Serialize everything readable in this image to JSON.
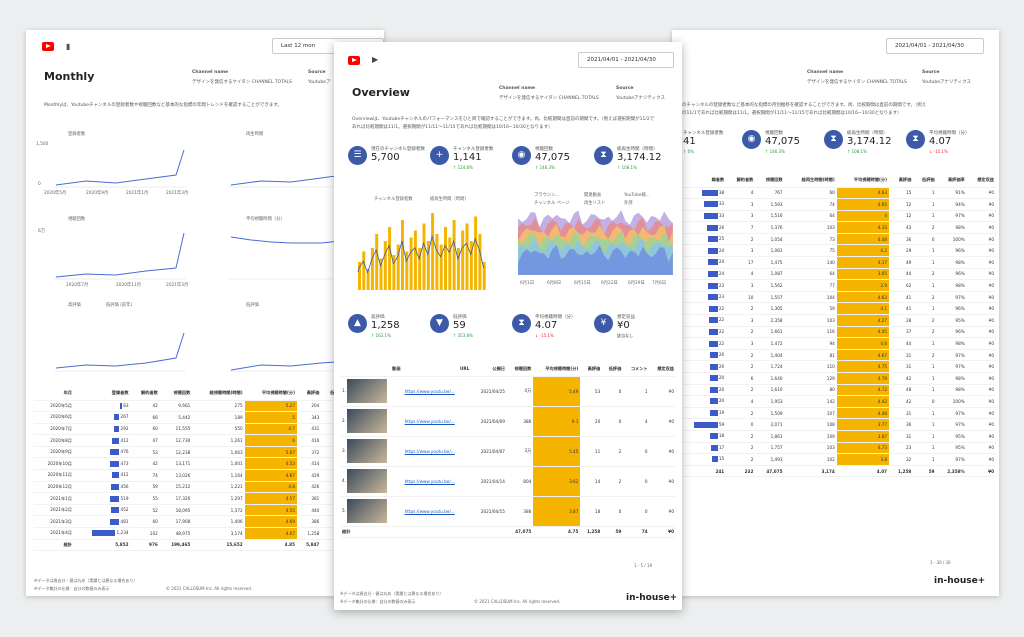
{
  "left": {
    "title": "Monthly",
    "selector": "Last 12 mon",
    "channel_label": "Channel name",
    "channel_value": "デザインを発信するケイタン CHANNEL TOTALS",
    "source_label": "Source",
    "source_value": "Youtubeア",
    "desc": "Monthlyは、Youtubeチャンネルの登録者数や視聴回数など基本的な指標の年間トレンドを確認することができます。",
    "chart_titles": [
      "登録者数",
      "再生時間",
      "視聴回数",
      "平均視聴時間（分）",
      "高評価",
      "低評価"
    ],
    "x_ticks": [
      "2020年5月",
      "2020年9月",
      "2021年1月",
      "2021年3月"
    ],
    "x_ticks_b": [
      "2020年7月",
      "2020年11月",
      "2021年3月"
    ],
    "y_ticks": [
      "1,500",
      "1,000",
      "500",
      "0"
    ],
    "y_ticks_b": [
      "6万",
      "4万",
      "2万",
      "0"
    ],
    "legend_hi": "高評価",
    "legend_lo": "低評価 (前年)",
    "cols": [
      "年月",
      "登録者数",
      "解約者数",
      "視聴回数",
      "総視聴時間(時間)",
      "平均視聴時間(分)",
      "高評価",
      "低評価",
      "高評価率"
    ],
    "rows": [
      [
        "2020年5月",
        "83",
        "42",
        "9,661",
        "275",
        "5.27",
        "204",
        "11",
        "95"
      ],
      [
        "2020年6月",
        "267",
        "66",
        "5,442",
        "189",
        "5",
        "343",
        "4",
        "98"
      ],
      [
        "2020年7月",
        "292",
        "60",
        "11,555",
        "550",
        "4.7",
        "431",
        "7",
        "98"
      ],
      [
        "2020年8月",
        "412",
        "47",
        "12,730",
        "1,261",
        "6",
        "410",
        "10",
        "97"
      ],
      [
        "2020年9月",
        "476",
        "53",
        "12,238",
        "1,063",
        "5.67",
        "372",
        "7",
        "97"
      ],
      [
        "2020年10月",
        "473",
        "42",
        "13,171",
        "1,001",
        "4.53",
        "414",
        "10",
        "97"
      ],
      [
        "2020年11月",
        "412",
        "74",
        "13,026",
        "1,164",
        "4.67",
        "429",
        "9",
        "97"
      ],
      [
        "2020年12月",
        "456",
        "59",
        "15,212",
        "1,221",
        "4.8",
        "426",
        "11",
        "97"
      ],
      [
        "2021年1月",
        "519",
        "55",
        "17,320",
        "1,297",
        "4.57",
        "381",
        "8",
        "97"
      ],
      [
        "2021年2月",
        "452",
        "52",
        "18,095",
        "1,372",
        "4.55",
        "440",
        "8",
        "98"
      ],
      [
        "2021年3月",
        "481",
        "60",
        "17,908",
        "1,406",
        "4.69",
        "386",
        "8",
        "98"
      ],
      [
        "2021年4月",
        "1,234",
        "102",
        "48,975",
        "3,174",
        "4.07",
        "1,258",
        "59",
        "95"
      ]
    ],
    "total": [
      "総計",
      "5,852",
      "976",
      "199,465",
      "15,652",
      "4.85",
      "5,847",
      "116",
      "1,1701"
    ],
    "foot1": "※データは過去分・値は丸め（実績とは異なる場合あり）",
    "foot2": "※データ集計の仕様：自分の数値のみ表示",
    "copyright": "© 2021 CALLOSUM Inc. All rights reserved."
  },
  "center": {
    "title": "Overview",
    "selector": "2021/04/01 - 2021/04/30",
    "channel_label": "Channel name",
    "channel_value": "デザインを発信するケイタン CHANNEL TOTALS",
    "source_label": "Source",
    "source_value": "Youtubeアナリティクス",
    "desc": "Overviewは、Youtubeチャンネルのパフォーマンスをひと目で確認することができます。尚、比較期間は直前の期間です。（例えば選択期間が11/2で",
    "desc2": "あれば比較期間は11/1。選択期間が11/11～11/15であれば比較期間は10/16~10/30となります）",
    "kpis1": [
      {
        "t": "現在のチャンネル登録者数",
        "v": "5,700",
        "d": "",
        "icon": "subscribers-icon"
      },
      {
        "t": "チャンネル登録者数",
        "v": "1,141",
        "d": "↑ 124.8%",
        "c": "up",
        "icon": "add-user-icon"
      },
      {
        "t": "視聴回数",
        "v": "47,075",
        "d": "↑ 146.3%",
        "c": "up",
        "icon": "eye-icon"
      },
      {
        "t": "総再生時間（時間）",
        "v": "3,174.12",
        "d": "↑ 108.1%",
        "c": "up",
        "icon": "hourglass-icon"
      }
    ],
    "kpis2": [
      {
        "t": "高評価",
        "v": "1,258",
        "d": "↑ 162.1%",
        "c": "up",
        "icon": "thumb-up-icon"
      },
      {
        "t": "低評価",
        "v": "59",
        "d": "↑ 353.8%",
        "c": "up",
        "icon": "thumb-down-icon"
      },
      {
        "t": "平均視聴時間（分）",
        "v": "4.07",
        "d": "↓ -15.1%",
        "c": "dn",
        "icon": "hourglass-icon"
      },
      {
        "t": "想定収益",
        "v": "¥0",
        "d": "該当なし",
        "c": "",
        "icon": "revenue-icon"
      }
    ],
    "legend_a": "チャンネル登録者数",
    "legend_b": "総再生時間（時間）",
    "legend_traffic": [
      "ブラウジン...",
      "関連動画",
      "YouTube検...",
      "チャンネル ページ",
      "再生リスト",
      "外部"
    ],
    "chart_ylab": [
      "150",
      "100",
      "50",
      "0"
    ],
    "chart_xlab": [
      "6月1日",
      "6月8日",
      "6月15日",
      "6月22日",
      "6月29日",
      "7月6日"
    ],
    "video_cols": [
      "動画",
      "URL",
      "公開日",
      "視聴回数",
      "平均視聴時間(分)",
      "高評価",
      "低評価",
      "コメント",
      "想定収益"
    ],
    "videos": [
      [
        "1.",
        "https://www.youtu.be/...",
        "2021/04/25",
        "4万",
        "5.49",
        "53",
        "0",
        "1",
        "¥0"
      ],
      [
        "2.",
        "https://www.youtu.be/...",
        "2021/04/09",
        "386",
        "9.1",
        "20",
        "0",
        "4",
        "¥0"
      ],
      [
        "3.",
        "https://www.youtu.be/...",
        "2021/04/07",
        "3万",
        "5.45",
        "11",
        "2",
        "0",
        "¥0"
      ],
      [
        "4.",
        "https://www.youtu.be/...",
        "2021/04/14",
        "804",
        "3.62",
        "14",
        "2",
        "0",
        "¥0"
      ],
      [
        "5.",
        "https://www.youtu.be/...",
        "2021/04/15",
        "386",
        "3.87",
        "18",
        "0",
        "0",
        "¥0"
      ]
    ],
    "video_total": [
      "総計",
      "47,075",
      "4.75",
      "1,258",
      "59",
      "74",
      "¥0"
    ],
    "pager": "1 - 5 / 19",
    "foot1": "※データは過去分・値は丸め（実績とは異なる場合あり）",
    "foot2": "※データ集計の仕様：自分の数値のみ表示",
    "copyright": "© 2021 CALLOSUM Inc. All rights reserved.",
    "brand": "in-house+"
  },
  "right": {
    "selector": "2021/04/01 - 2021/04/30",
    "source_label": "Source",
    "source_value": "Youtubeアナリティクス",
    "channel_label": "Channel name",
    "channel_value": "デザインを発信するケイタン CHANNEL TOTALS",
    "desc": "のチャンネルの登録者数など基本的な指標の月別推移を確認することができます。尚、比較期間は直前の期間です。（例え",
    "desc2": "の11/1であれば比較期間は11/1。選択期間が11/11～11/15であれば比較期間は10/16~10/30となります）",
    "kpis": [
      {
        "t": "チャンネル登録者数",
        "v": "41",
        "d": "↑ 0%",
        "c": "up",
        "icon": "subscribers-icon"
      },
      {
        "t": "視聴回数",
        "v": "47,075",
        "d": "↑ 146.3%",
        "c": "up",
        "icon": "eye-icon"
      },
      {
        "t": "総再生時間（時間）",
        "v": "3,174.12",
        "d": "↑ 108.1%",
        "c": "up",
        "icon": "hourglass-icon"
      },
      {
        "t": "平均視聴時間（分）",
        "v": "4.07",
        "d": "↓ -15.1%",
        "c": "dn",
        "icon": "hourglass-icon"
      }
    ],
    "cols": [
      "録者数",
      "解約者数",
      "視聴回数",
      "総再生時間(時間)",
      "平均視聴時間(分)",
      "高評価",
      "低評価",
      "高評価率",
      "想定収益"
    ],
    "rows": [
      [
        "38",
        "4",
        "767",
        "60",
        "4.63",
        "15",
        "1",
        "91%",
        "¥0"
      ],
      [
        "33",
        "3",
        "1,593",
        "74",
        "4.65",
        "12",
        "1",
        "94%",
        "¥0"
      ],
      [
        "33",
        "3",
        "1,516",
        "64",
        "4",
        "12",
        "1",
        "97%",
        "¥0"
      ],
      [
        "26",
        "7",
        "1,376",
        "103",
        "4.33",
        "43",
        "2",
        "98%",
        "¥0"
      ],
      [
        "25",
        "2",
        "1,054",
        "73",
        "4.48",
        "36",
        "0",
        "100%",
        "¥0"
      ],
      [
        "24",
        "3",
        "1,081",
        "75",
        "4.2",
        "29",
        "1",
        "96%",
        "¥0"
      ],
      [
        "24",
        "17",
        "1,475",
        "140",
        "4.17",
        "49",
        "1",
        "98%",
        "¥0"
      ],
      [
        "24",
        "4",
        "1,087",
        "64",
        "3.65",
        "44",
        "2",
        "96%",
        "¥0"
      ],
      [
        "23",
        "3",
        "1,562",
        "77",
        "2.9",
        "62",
        "1",
        "98%",
        "¥0"
      ],
      [
        "23",
        "10",
        "1,557",
        "104",
        "4.63",
        "41",
        "2",
        "97%",
        "¥0"
      ],
      [
        "22",
        "2",
        "1,305",
        "59",
        "4.1",
        "41",
        "1",
        "96%",
        "¥0"
      ],
      [
        "22",
        "3",
        "2,358",
        "103",
        "4.27",
        "28",
        "2",
        "95%",
        "¥0"
      ],
      [
        "22",
        "2",
        "1,661",
        "116",
        "4.45",
        "37",
        "2",
        "96%",
        "¥0"
      ],
      [
        "22",
        "3",
        "1,472",
        "94",
        "4.6",
        "44",
        "1",
        "98%",
        "¥0"
      ],
      [
        "20",
        "2",
        "1,404",
        "81",
        "4.67",
        "31",
        "2",
        "97%",
        "¥0"
      ],
      [
        "20",
        "2",
        "1,724",
        "110",
        "4.75",
        "31",
        "1",
        "97%",
        "¥0"
      ],
      [
        "20",
        "6",
        "1,640",
        "129",
        "4.78",
        "42",
        "1",
        "98%",
        "¥0"
      ],
      [
        "20",
        "2",
        "1,610",
        "80",
        "4.72",
        "48",
        "1",
        "98%",
        "¥0"
      ],
      [
        "20",
        "4",
        "1,953",
        "142",
        "4.42",
        "42",
        "0",
        "100%",
        "¥0"
      ],
      [
        "19",
        "2",
        "1,509",
        "107",
        "4.48",
        "31",
        "1",
        "97%",
        "¥0"
      ],
      [
        "59",
        "0",
        "2,071",
        "108",
        "3.77",
        "36",
        "1",
        "97%",
        "¥0"
      ],
      [
        "18",
        "2",
        "1,861",
        "109",
        "3.87",
        "31",
        "1",
        "95%",
        "¥0"
      ],
      [
        "17",
        "2",
        "1,757",
        "103",
        "4.73",
        "23",
        "1",
        "95%",
        "¥0"
      ],
      [
        "15",
        "2",
        "1,493",
        "102",
        "3.8",
        "32",
        "1",
        "97%",
        "¥0"
      ]
    ],
    "total": [
      "241",
      "232",
      "47,075",
      "3,174",
      "4.07",
      "1,258",
      "59",
      "2,358%",
      "¥0"
    ],
    "pager": "1 - 30 / 30",
    "brand": "in-house+"
  }
}
